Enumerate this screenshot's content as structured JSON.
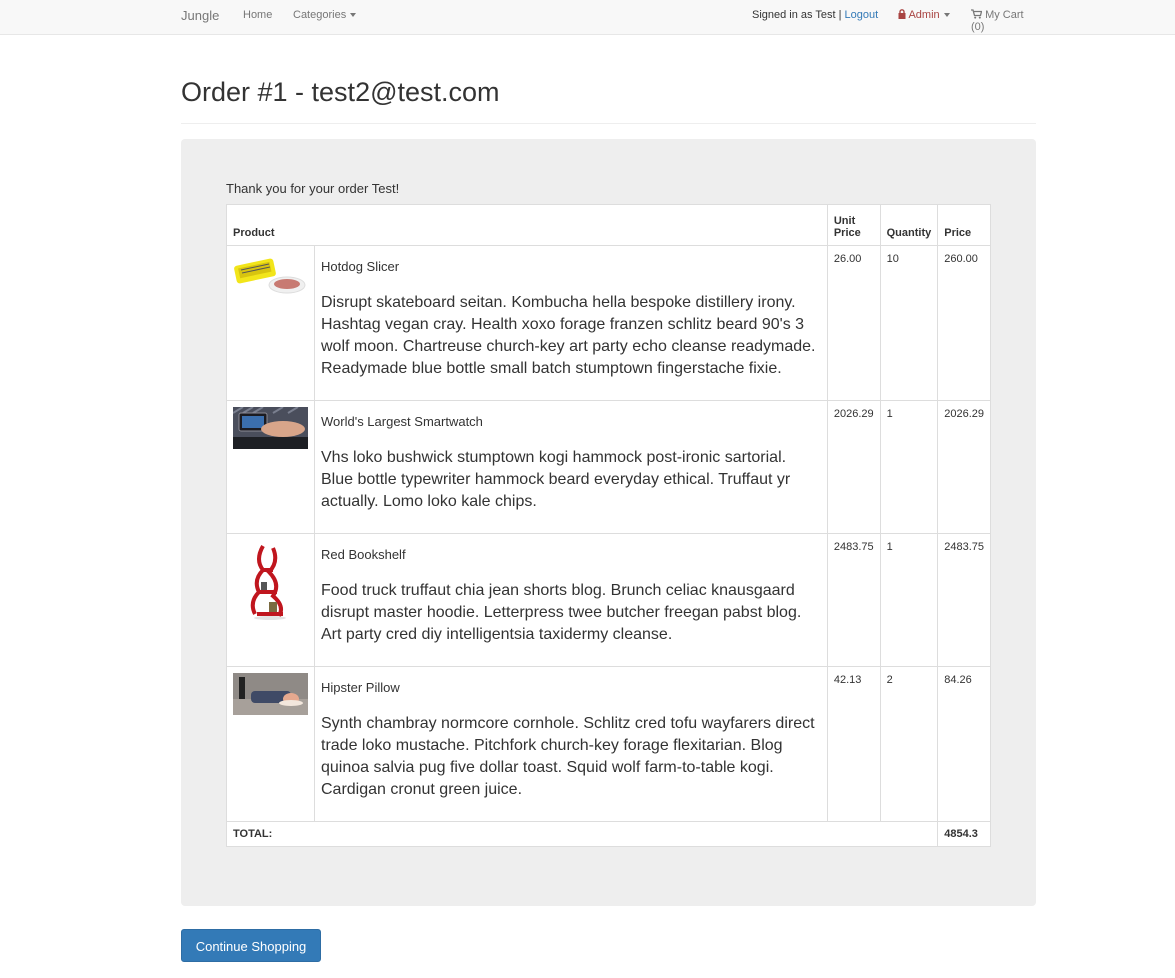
{
  "navbar": {
    "brand": "Jungle",
    "home": "Home",
    "categories": "Categories",
    "signed_in_text": "Signed in as Test | ",
    "logout": "Logout",
    "admin": "Admin",
    "cart": "My Cart (0)"
  },
  "page": {
    "title": "Order #1 - test2@test.com",
    "thanks": "Thank you for your order Test!"
  },
  "table": {
    "headers": {
      "product": "Product",
      "unit_price": "Unit Price",
      "quantity": "Quantity",
      "price": "Price"
    },
    "rows": [
      {
        "name": "Hotdog Slicer",
        "description": "Disrupt skateboard seitan. Kombucha hella bespoke distillery irony. Hashtag vegan cray. Health xoxo forage franzen schlitz beard 90's 3 wolf moon. Chartreuse church-key art party echo cleanse readymade. Readymade blue bottle small batch stumptown fingerstache fixie.",
        "unit_price": "26.00",
        "quantity": "10",
        "price": "260.00"
      },
      {
        "name": "World's Largest Smartwatch",
        "description": "Vhs loko bushwick stumptown kogi hammock post-ironic sartorial. Blue bottle typewriter hammock beard everyday ethical. Truffaut yr actually. Lomo loko kale chips.",
        "unit_price": "2026.29",
        "quantity": "1",
        "price": "2026.29"
      },
      {
        "name": "Red Bookshelf",
        "description": "Food truck truffaut chia jean shorts blog. Brunch celiac knausgaard disrupt master hoodie. Letterpress twee butcher freegan pabst blog. Art party cred diy intelligentsia taxidermy cleanse.",
        "unit_price": "2483.75",
        "quantity": "1",
        "price": "2483.75"
      },
      {
        "name": "Hipster Pillow",
        "description": "Synth chambray normcore cornhole. Schlitz cred tofu wayfarers direct trade loko mustache. Pitchfork church-key forage flexitarian. Blog quinoa salvia pug five dollar toast. Squid wolf farm-to-table kogi. Cardigan cronut green juice.",
        "unit_price": "42.13",
        "quantity": "2",
        "price": "84.26"
      }
    ],
    "total_label": "TOTAL:",
    "total_value": "4854.3"
  },
  "actions": {
    "continue_shopping": "Continue Shopping"
  },
  "icons": {
    "admin": "lock-icon",
    "cart": "cart-icon"
  },
  "colors": {
    "primary": "#337ab7",
    "admin": "#a94442",
    "well": "#eeeeee"
  }
}
